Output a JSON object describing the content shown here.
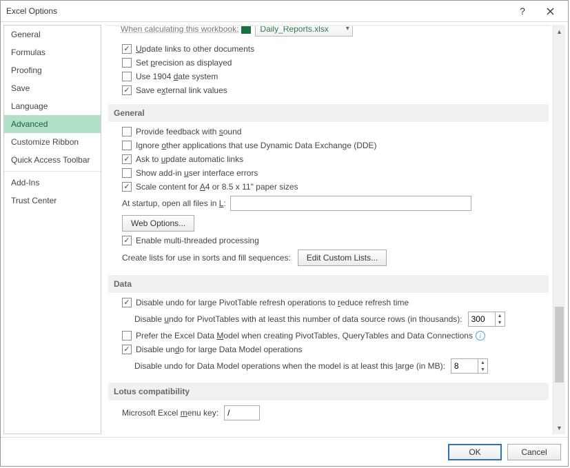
{
  "titlebar": {
    "title": "Excel Options"
  },
  "sidebar": {
    "items": [
      {
        "label": "General"
      },
      {
        "label": "Formulas"
      },
      {
        "label": "Proofing"
      },
      {
        "label": "Save"
      },
      {
        "label": "Language"
      },
      {
        "label": "Advanced"
      },
      {
        "label": "Customize Ribbon"
      },
      {
        "label": "Quick Access Toolbar"
      },
      {
        "label": "Add-Ins"
      },
      {
        "label": "Trust Center"
      }
    ],
    "selected_index": 5
  },
  "content": {
    "cutoff": {
      "prefix": "When calculating this workbook:",
      "file": "Daily_Reports.xlsx"
    },
    "calc_section": {
      "opts": [
        {
          "checked": true,
          "pre": "",
          "u": "U",
          "post": "pdate links to other documents"
        },
        {
          "checked": false,
          "pre": "Set ",
          "u": "p",
          "post": "recision as displayed"
        },
        {
          "checked": false,
          "pre": "Use 1904 ",
          "u": "d",
          "post": "ate system"
        },
        {
          "checked": true,
          "pre": "Save e",
          "u": "x",
          "post": "ternal link values"
        }
      ]
    },
    "general_section": {
      "header": "General",
      "opts": [
        {
          "checked": false,
          "pre": "Provide feedback with ",
          "u": "s",
          "post": "ound"
        },
        {
          "checked": false,
          "pre": "Ignore ",
          "u": "o",
          "post": "ther applications that use Dynamic Data Exchange (DDE)"
        },
        {
          "checked": true,
          "pre": "Ask to ",
          "u": "u",
          "post": "pdate automatic links"
        },
        {
          "checked": false,
          "pre": "Show add-in ",
          "u": "u",
          "post": "ser interface errors"
        },
        {
          "checked": true,
          "pre": "Scale content for ",
          "u": "A",
          "post": "4 or 8.5 x 11\" paper sizes"
        }
      ],
      "startup": {
        "pre": "At startup, open all files in ",
        "u": "L",
        "post": ":",
        "value": ""
      },
      "web_options_btn": "Web Options...",
      "multithread": {
        "checked": true,
        "text": "Enable multi-threaded processing"
      },
      "lists_label": "Create lists for use in sorts and fill sequences:",
      "edit_lists_btn": "Edit Custom Lists..."
    },
    "data_section": {
      "header": "Data",
      "opt1": {
        "checked": true,
        "pre": "Disable undo for large PivotTable refresh operations to ",
        "u": "r",
        "post": "educe refresh time"
      },
      "row2": {
        "pre": "Disable ",
        "u": "u",
        "post": "ndo for PivotTables with at least this number of data source rows (in thousands):",
        "value": "300"
      },
      "opt3": {
        "checked": false,
        "pre": "Prefer the Excel Data ",
        "u": "M",
        "post": "odel when creating PivotTables, QueryTables and Data Connections"
      },
      "opt4": {
        "checked": true,
        "pre": "Disable un",
        "u": "d",
        "post": "o for large Data Model operations"
      },
      "row5": {
        "pre": "Disable undo for Data Model operations when the model is at least this ",
        "u": "l",
        "post": "arge (in MB):",
        "value": "8"
      }
    },
    "lotus_section": {
      "header": "Lotus compatibility",
      "menu_key": {
        "pre": "Microsoft Excel ",
        "u": "m",
        "post": "enu key:",
        "value": "/"
      }
    }
  },
  "footer": {
    "ok": "OK",
    "cancel": "Cancel"
  }
}
